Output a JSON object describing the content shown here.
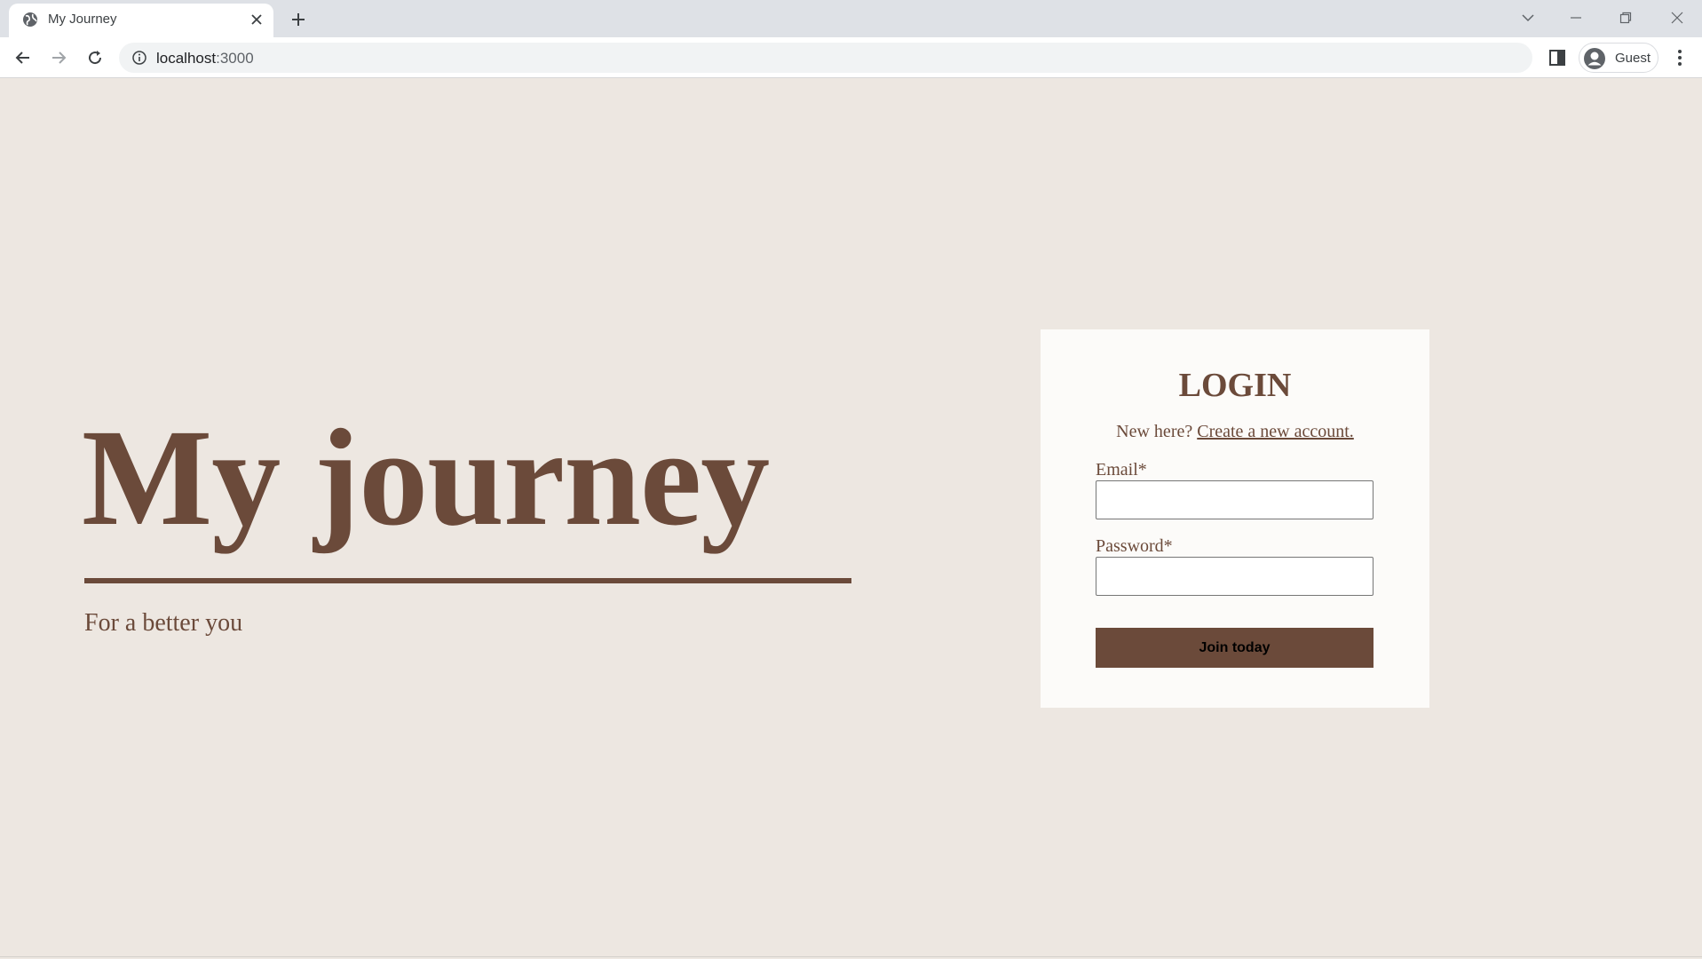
{
  "browser": {
    "tab_title": "My Journey",
    "url_host": "localhost",
    "url_port": ":3000",
    "profile_label": "Guest"
  },
  "hero": {
    "title": "My journey",
    "tagline": "For a better you"
  },
  "login": {
    "title": "LOGIN",
    "new_here": "New here?",
    "create_link": "Create a new account.",
    "email_label": "Email*",
    "email_value": "",
    "password_label": "Password*",
    "password_value": "",
    "submit_label": "Join today"
  },
  "colors": {
    "page_bg": "#ede7e1",
    "card_bg": "#fcfbf9",
    "accent": "#6b4a3a"
  }
}
